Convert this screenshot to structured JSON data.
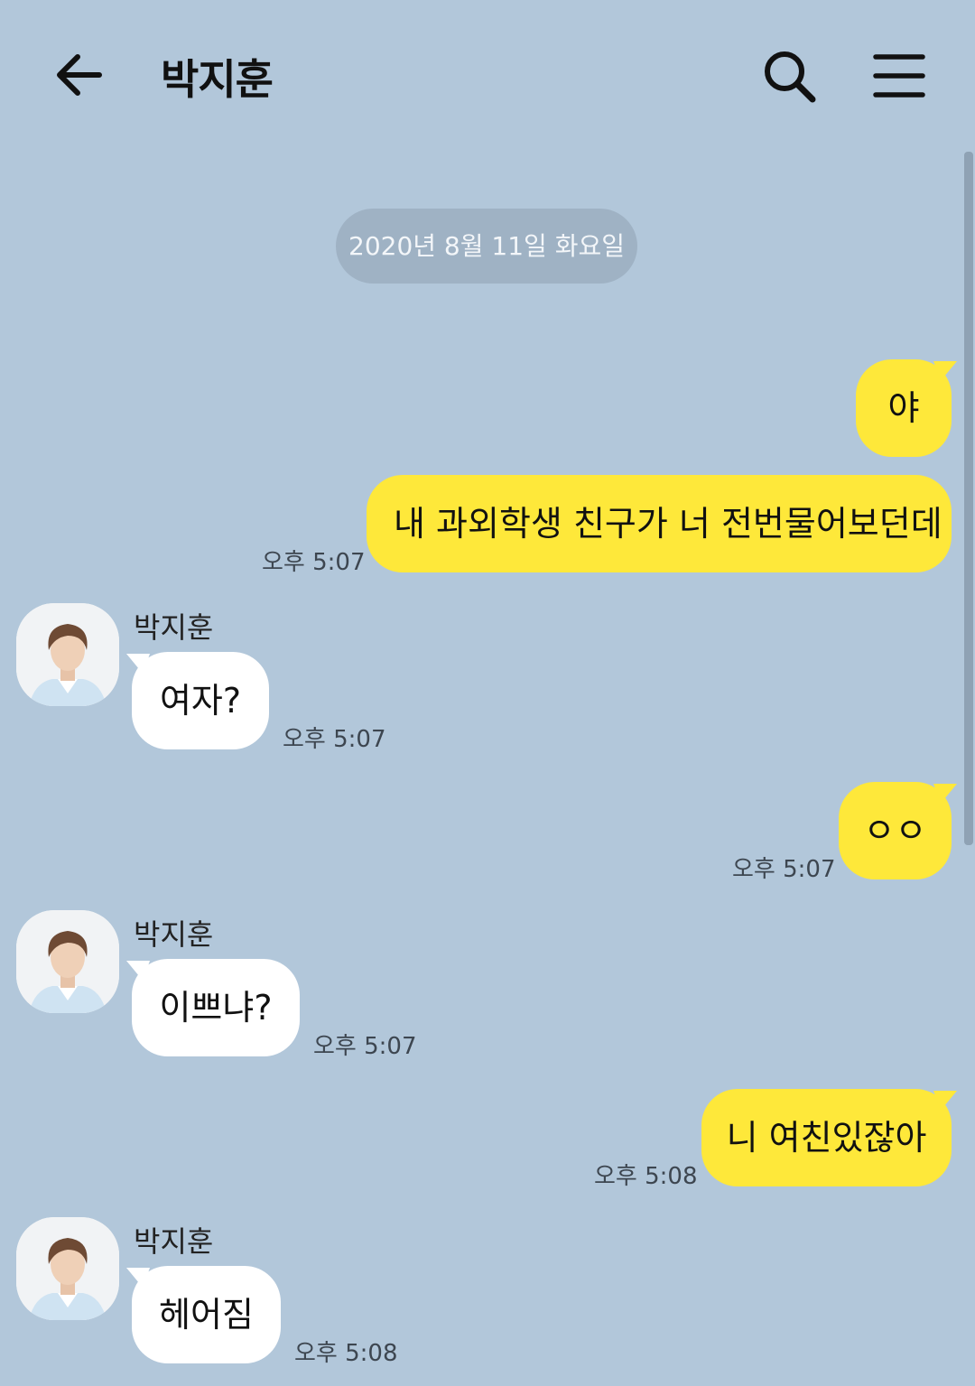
{
  "header": {
    "title": "박지훈",
    "back_icon": "arrow-left-icon",
    "search_icon": "search-icon",
    "menu_icon": "hamburger-menu-icon"
  },
  "chat": {
    "date_divider": "2020년 8월 11일 화요일",
    "messages": [
      {
        "from": "me",
        "text": "야",
        "time": ""
      },
      {
        "from": "me",
        "text": "내 과외학생 친구가 너 전번물어보던데",
        "time": "오후 5:07"
      },
      {
        "from": "other",
        "sender": "박지훈",
        "text": "여자?",
        "time": "오후 5:07"
      },
      {
        "from": "me",
        "text": "ㅇㅇ",
        "time": "오후 5:07"
      },
      {
        "from": "other",
        "sender": "박지훈",
        "text": "이쁘냐?",
        "time": "오후 5:07"
      },
      {
        "from": "me",
        "text": "니 여친있잖아",
        "time": "오후 5:08"
      },
      {
        "from": "other",
        "sender": "박지훈",
        "text": "헤어짐",
        "time": "오후 5:08"
      }
    ]
  },
  "colors": {
    "background": "#b2c7da",
    "my_bubble": "#fee83a",
    "their_bubble": "#ffffff"
  }
}
